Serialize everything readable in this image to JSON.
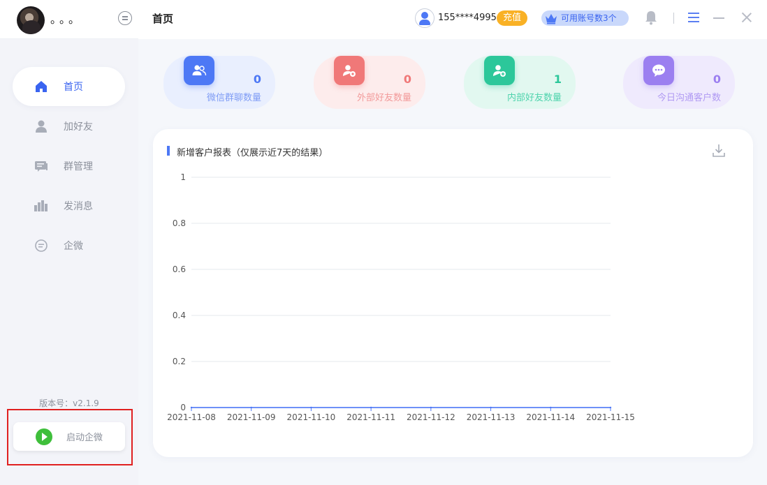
{
  "user": {
    "name": "。。。"
  },
  "sidebar": {
    "items": [
      {
        "label": "首页",
        "icon": "home-icon",
        "active": true
      },
      {
        "label": "加好友",
        "icon": "person-icon",
        "active": false
      },
      {
        "label": "群管理",
        "icon": "group-chat-icon",
        "active": false
      },
      {
        "label": "发消息",
        "icon": "message-bars-icon",
        "active": false
      },
      {
        "label": "企微",
        "icon": "chat-bubble-icon",
        "active": false
      }
    ],
    "version": "版本号：v2.1.9",
    "launch_label": "启动企微"
  },
  "header": {
    "title": "首页",
    "phone": "155****4995",
    "recharge_label": "充值",
    "accounts_label": "可用账号数3个"
  },
  "stats": [
    {
      "value": "0",
      "label": "微信群聊数量",
      "color": "#4d78f5",
      "bg": "#e9effe",
      "icon": "group-icon"
    },
    {
      "value": "0",
      "label": "外部好友数量",
      "color": "#f07878",
      "bg": "#fdecec",
      "icon": "external-friend-icon"
    },
    {
      "value": "1",
      "label": "内部好友数量",
      "color": "#2cc79a",
      "bg": "#e2f8f0",
      "icon": "add-friend-icon"
    },
    {
      "value": "0",
      "label": "今日沟通客户数",
      "color": "#9b7ff0",
      "bg": "#efeafd",
      "icon": "chat-icon"
    }
  ],
  "chart": {
    "title": "新增客户报表（仅展示近7天的结果）"
  },
  "chart_data": {
    "type": "line",
    "title": "新增客户报表（仅展示近7天的结果）",
    "xlabel": "",
    "ylabel": "",
    "x": [
      "2021-11-08",
      "2021-11-09",
      "2021-11-10",
      "2021-11-11",
      "2021-11-12",
      "2021-11-13",
      "2021-11-14",
      "2021-11-15"
    ],
    "series": [
      {
        "values": [
          0,
          0,
          0,
          0,
          0,
          0,
          0,
          0
        ],
        "color": "#4d78f5"
      }
    ],
    "ylim": [
      0,
      1
    ],
    "yticks": [
      "0",
      "0.2",
      "0.4",
      "0.6",
      "0.8",
      "1"
    ],
    "grid": true
  }
}
